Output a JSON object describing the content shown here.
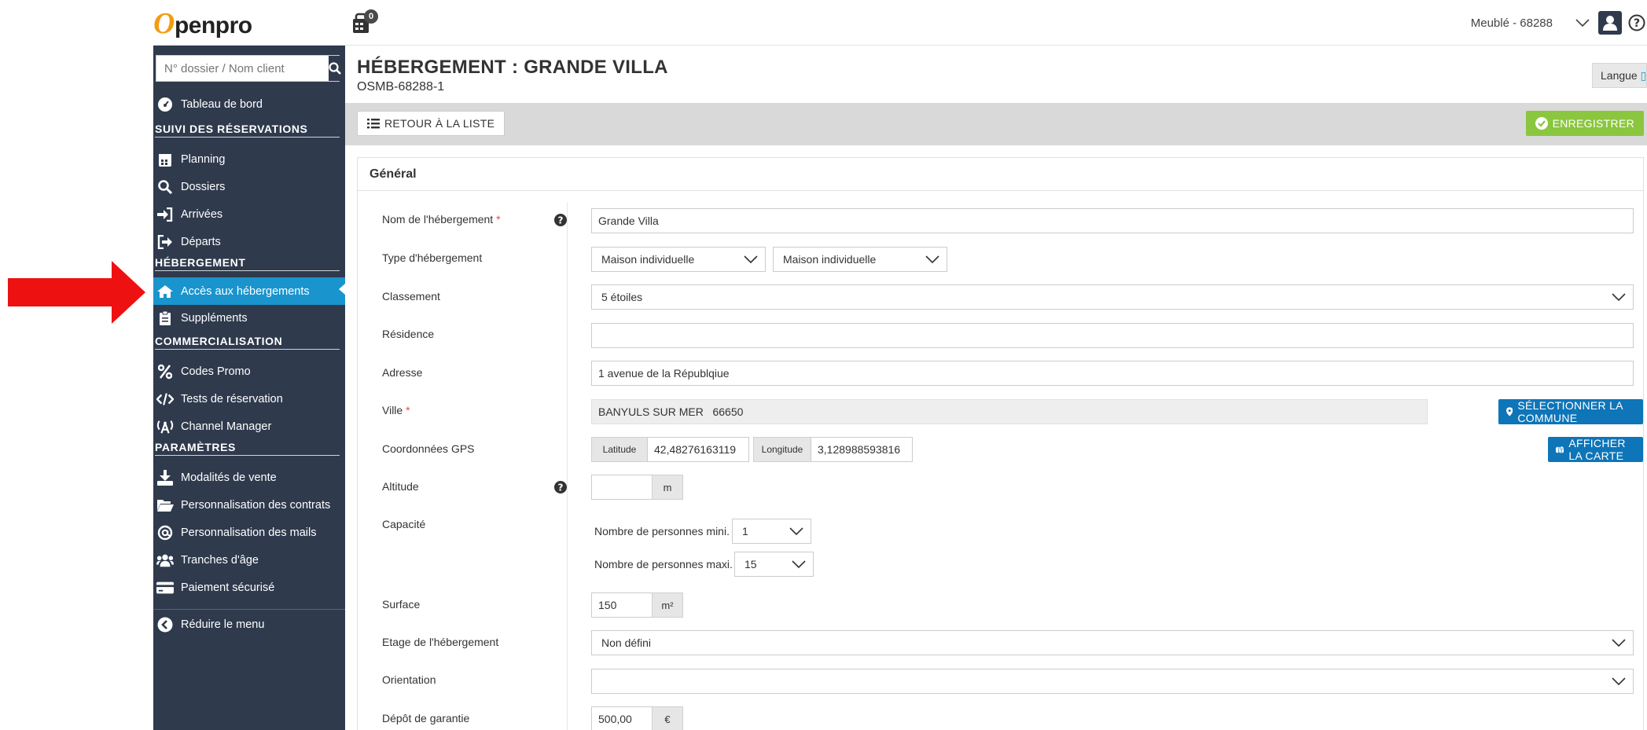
{
  "app": {
    "logo_text": "penpro",
    "logo_letter": "O",
    "cart_count": "0",
    "site_selector": "Meublé - 68288"
  },
  "sidebar": {
    "search_placeholder": "N° dossier / Nom client",
    "dashboard": "Tableau de bord",
    "sections": {
      "suivi": "SUIVI DES RÉSERVATIONS",
      "hebergement": "HÉBERGEMENT",
      "commercialisation": "COMMERCIALISATION",
      "parametres": "PARAMÈTRES"
    },
    "items": {
      "planning": "Planning",
      "dossiers": "Dossiers",
      "arrivees": "Arrivées",
      "departs": "Départs",
      "acces_hebergements": "Accès aux hébergements",
      "supplements": "Suppléments",
      "codes_promo": "Codes Promo",
      "tests_reservation": "Tests de réservation",
      "channel_manager": "Channel Manager",
      "modalites_vente": "Modalités de vente",
      "perso_contrats": "Personnalisation des contrats",
      "perso_mails": "Personnalisation des mails",
      "tranches_age": "Tranches d'âge",
      "paiement_securise": "Paiement sécurisé",
      "reduire_menu": "Réduire le menu"
    },
    "active_item": "acces_hebergements"
  },
  "header": {
    "title": "HÉBERGEMENT : GRANDE VILLA",
    "subtitle": "OSMB-68288-1",
    "langue_label": "Langue"
  },
  "toolbar": {
    "back_label": "RETOUR À LA LISTE",
    "save_label": "ENREGISTRER"
  },
  "form": {
    "panel_title": "Général",
    "labels": {
      "nom": "Nom de l'hébergement",
      "type": "Type d'hébergement",
      "classement": "Classement",
      "residence": "Résidence",
      "adresse": "Adresse",
      "ville": "Ville",
      "gps": "Coordonnées GPS",
      "altitude": "Altitude",
      "capacite": "Capacité",
      "surface": "Surface",
      "etage": "Etage de l'hébergement",
      "orientation": "Orientation",
      "depot": "Dépôt de garantie"
    },
    "required_mark": "*",
    "values": {
      "nom": "Grande Villa",
      "type_1": "Maison individuelle",
      "type_2": "Maison individuelle",
      "classement": "5 étoiles",
      "residence": "",
      "adresse": "1 avenue de la Républqiue",
      "ville": "BANYULS SUR MER   66650",
      "latitude_label": "Latitude",
      "latitude": "42,48276163119",
      "longitude_label": "Longitude",
      "longitude": "3,128988593816",
      "altitude": "",
      "altitude_unit": "m",
      "pers_mini_label": "Nombre de personnes mini.",
      "pers_mini": "1",
      "pers_maxi_label": "Nombre de personnes maxi.",
      "pers_maxi": "15",
      "surface": "150",
      "surface_unit": "m²",
      "etage": "Non défini",
      "orientation": "",
      "depot": "500,00",
      "depot_unit": "€"
    },
    "buttons": {
      "select_commune": "SÉLECTIONNER LA COMMUNE",
      "afficher_carte": "AFFICHER LA CARTE"
    }
  },
  "colors": {
    "sidebar_bg": "#2f3a4d",
    "active_blue": "#1a94cd",
    "save_green": "#8bc63f",
    "button_blue": "#0e75b8",
    "annotation_red": "#ee1111"
  }
}
